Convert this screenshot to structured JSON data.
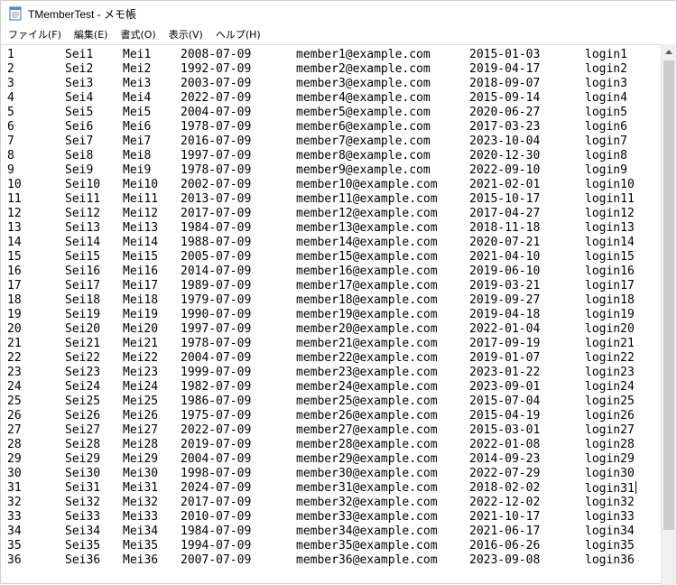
{
  "window": {
    "title": "TMemberTest - メモ帳"
  },
  "menu": [
    "ファイル(F)",
    "編集(E)",
    "書式(O)",
    "表示(V)",
    "ヘルプ(H)"
  ],
  "rows": [
    [
      "1",
      "Sei1",
      "Mei1",
      "2008-07-09",
      "member1@example.com",
      "2015-01-03",
      "login1"
    ],
    [
      "2",
      "Sei2",
      "Mei2",
      "1992-07-09",
      "member2@example.com",
      "2019-04-17",
      "login2"
    ],
    [
      "3",
      "Sei3",
      "Mei3",
      "2003-07-09",
      "member3@example.com",
      "2018-09-07",
      "login3"
    ],
    [
      "4",
      "Sei4",
      "Mei4",
      "2022-07-09",
      "member4@example.com",
      "2015-09-14",
      "login4"
    ],
    [
      "5",
      "Sei5",
      "Mei5",
      "2004-07-09",
      "member5@example.com",
      "2020-06-27",
      "login5"
    ],
    [
      "6",
      "Sei6",
      "Mei6",
      "1978-07-09",
      "member6@example.com",
      "2017-03-23",
      "login6"
    ],
    [
      "7",
      "Sei7",
      "Mei7",
      "2016-07-09",
      "member7@example.com",
      "2023-10-04",
      "login7"
    ],
    [
      "8",
      "Sei8",
      "Mei8",
      "1997-07-09",
      "member8@example.com",
      "2020-12-30",
      "login8"
    ],
    [
      "9",
      "Sei9",
      "Mei9",
      "1978-07-09",
      "member9@example.com",
      "2022-09-10",
      "login9"
    ],
    [
      "10",
      "Sei10",
      "Mei10",
      "2002-07-09",
      "member10@example.com",
      "2021-02-01",
      "login10"
    ],
    [
      "11",
      "Sei11",
      "Mei11",
      "2013-07-09",
      "member11@example.com",
      "2015-10-17",
      "login11"
    ],
    [
      "12",
      "Sei12",
      "Mei12",
      "2017-07-09",
      "member12@example.com",
      "2017-04-27",
      "login12"
    ],
    [
      "13",
      "Sei13",
      "Mei13",
      "1984-07-09",
      "member13@example.com",
      "2018-11-18",
      "login13"
    ],
    [
      "14",
      "Sei14",
      "Mei14",
      "1988-07-09",
      "member14@example.com",
      "2020-07-21",
      "login14"
    ],
    [
      "15",
      "Sei15",
      "Mei15",
      "2005-07-09",
      "member15@example.com",
      "2021-04-10",
      "login15"
    ],
    [
      "16",
      "Sei16",
      "Mei16",
      "2014-07-09",
      "member16@example.com",
      "2019-06-10",
      "login16"
    ],
    [
      "17",
      "Sei17",
      "Mei17",
      "1989-07-09",
      "member17@example.com",
      "2019-03-21",
      "login17"
    ],
    [
      "18",
      "Sei18",
      "Mei18",
      "1979-07-09",
      "member18@example.com",
      "2019-09-27",
      "login18"
    ],
    [
      "19",
      "Sei19",
      "Mei19",
      "1990-07-09",
      "member19@example.com",
      "2019-04-18",
      "login19"
    ],
    [
      "20",
      "Sei20",
      "Mei20",
      "1997-07-09",
      "member20@example.com",
      "2022-01-04",
      "login20"
    ],
    [
      "21",
      "Sei21",
      "Mei21",
      "1978-07-09",
      "member21@example.com",
      "2017-09-19",
      "login21"
    ],
    [
      "22",
      "Sei22",
      "Mei22",
      "2004-07-09",
      "member22@example.com",
      "2019-01-07",
      "login22"
    ],
    [
      "23",
      "Sei23",
      "Mei23",
      "1999-07-09",
      "member23@example.com",
      "2023-01-22",
      "login23"
    ],
    [
      "24",
      "Sei24",
      "Mei24",
      "1982-07-09",
      "member24@example.com",
      "2023-09-01",
      "login24"
    ],
    [
      "25",
      "Sei25",
      "Mei25",
      "1986-07-09",
      "member25@example.com",
      "2015-07-04",
      "login25"
    ],
    [
      "26",
      "Sei26",
      "Mei26",
      "1975-07-09",
      "member26@example.com",
      "2015-04-19",
      "login26"
    ],
    [
      "27",
      "Sei27",
      "Mei27",
      "2022-07-09",
      "member27@example.com",
      "2015-03-01",
      "login27"
    ],
    [
      "28",
      "Sei28",
      "Mei28",
      "2019-07-09",
      "member28@example.com",
      "2022-01-08",
      "login28"
    ],
    [
      "29",
      "Sei29",
      "Mei29",
      "2004-07-09",
      "member29@example.com",
      "2014-09-23",
      "login29"
    ],
    [
      "30",
      "Sei30",
      "Mei30",
      "1998-07-09",
      "member30@example.com",
      "2022-07-29",
      "login30"
    ],
    [
      "31",
      "Sei31",
      "Mei31",
      "2024-07-09",
      "member31@example.com",
      "2018-02-02",
      "login31"
    ],
    [
      "32",
      "Sei32",
      "Mei32",
      "2017-07-09",
      "member32@example.com",
      "2022-12-02",
      "login32"
    ],
    [
      "33",
      "Sei33",
      "Mei33",
      "2010-07-09",
      "member33@example.com",
      "2021-10-17",
      "login33"
    ],
    [
      "34",
      "Sei34",
      "Mei34",
      "1984-07-09",
      "member34@example.com",
      "2021-06-17",
      "login34"
    ],
    [
      "35",
      "Sei35",
      "Mei35",
      "1994-07-09",
      "member35@example.com",
      "2016-06-26",
      "login35"
    ],
    [
      "36",
      "Sei36",
      "Mei36",
      "2007-07-09",
      "member36@example.com",
      "2023-09-08",
      "login36"
    ]
  ],
  "caret_row": 31,
  "icons": {
    "app": "notepad-icon"
  }
}
